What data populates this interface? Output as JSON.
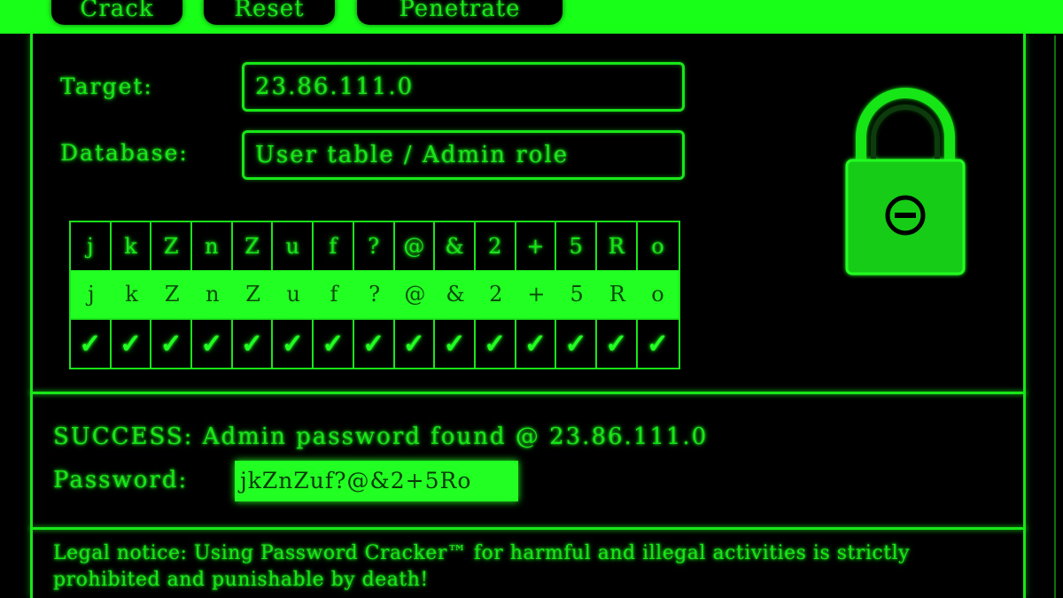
{
  "toolbar": {
    "crack_label": "Crack",
    "reset_label": "Reset",
    "penetrate_label": "Penetrate"
  },
  "form": {
    "target_label": "Target:",
    "target_value": "23.86.111.0",
    "database_label": "Database:",
    "database_value": "User table / Admin role"
  },
  "grid": {
    "top_chars": [
      "j",
      "k",
      "Z",
      "n",
      "Z",
      "u",
      "f",
      "?",
      "@",
      "&",
      "2",
      "+",
      "5",
      "R",
      "o"
    ],
    "mid_chars": [
      "j",
      "k",
      "Z",
      "n",
      "Z",
      "u",
      "f",
      "?",
      "@",
      "&",
      "2",
      "+",
      "5",
      "R",
      "o"
    ],
    "checks": [
      "✓",
      "✓",
      "✓",
      "✓",
      "✓",
      "✓",
      "✓",
      "✓",
      "✓",
      "✓",
      "✓",
      "✓",
      "✓",
      "✓",
      "✓"
    ]
  },
  "lock": {
    "icon": "padlock-icon",
    "state": "locked"
  },
  "result": {
    "success_text": "SUCCESS: Admin password found @ 23.86.111.0",
    "password_label": "Password:",
    "password_value": "jkZnZuf?@&2+5Ro"
  },
  "legal": {
    "notice": "Legal notice: Using Password Cracker™ for harmful and illegal activities is strictly prohibited and punishable by death!"
  },
  "colors": {
    "background": "#000000",
    "accent": "#19e619",
    "highlight": "#22ff22"
  }
}
